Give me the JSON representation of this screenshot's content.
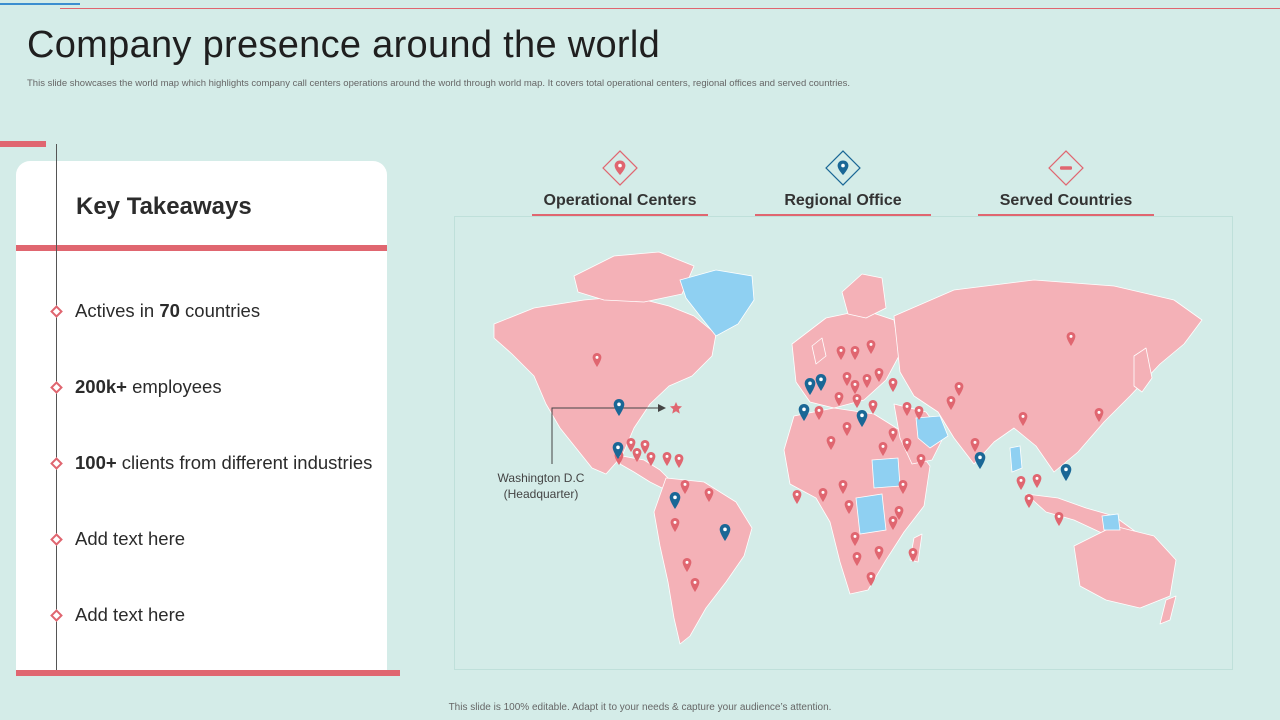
{
  "slide": {
    "title": "Company presence around the world",
    "subtitle": "This slide showcases the world map which highlights company call centers operations around the world through world map. It covers total operational centers, regional offices and served countries."
  },
  "takeaways": {
    "heading": "Key Takeaways",
    "items": [
      {
        "prefix": "Actives in ",
        "bold": "70",
        "suffix": " countries"
      },
      {
        "prefix": "",
        "bold": "200k+",
        "suffix": " employees"
      },
      {
        "prefix": "",
        "bold": "100+",
        "suffix": " clients from different industries"
      },
      {
        "prefix": "Add text here",
        "bold": "",
        "suffix": ""
      },
      {
        "prefix": "Add text here",
        "bold": "",
        "suffix": ""
      }
    ]
  },
  "legend": [
    {
      "label": "Operational Centers",
      "icon": "map-pin-icon",
      "color": "#e06670"
    },
    {
      "label": "Regional Office",
      "icon": "map-pin-icon",
      "color": "#1a6796"
    },
    {
      "label": "Served Countries",
      "icon": "minus-icon",
      "color": "#e06670"
    }
  ],
  "map": {
    "headquarter_label_line1": "Washington D.C",
    "headquarter_label_line2": "(Headquarter)",
    "colors": {
      "land": "#f4b1b7",
      "water_body": "#8fd0f2",
      "operational_pin": "#e06670",
      "regional_pin": "#1a6796",
      "headquarter_star": "#e06670"
    }
  },
  "footer": "This slide is 100% editable. Adapt it to your needs & capture your audience’s attention."
}
